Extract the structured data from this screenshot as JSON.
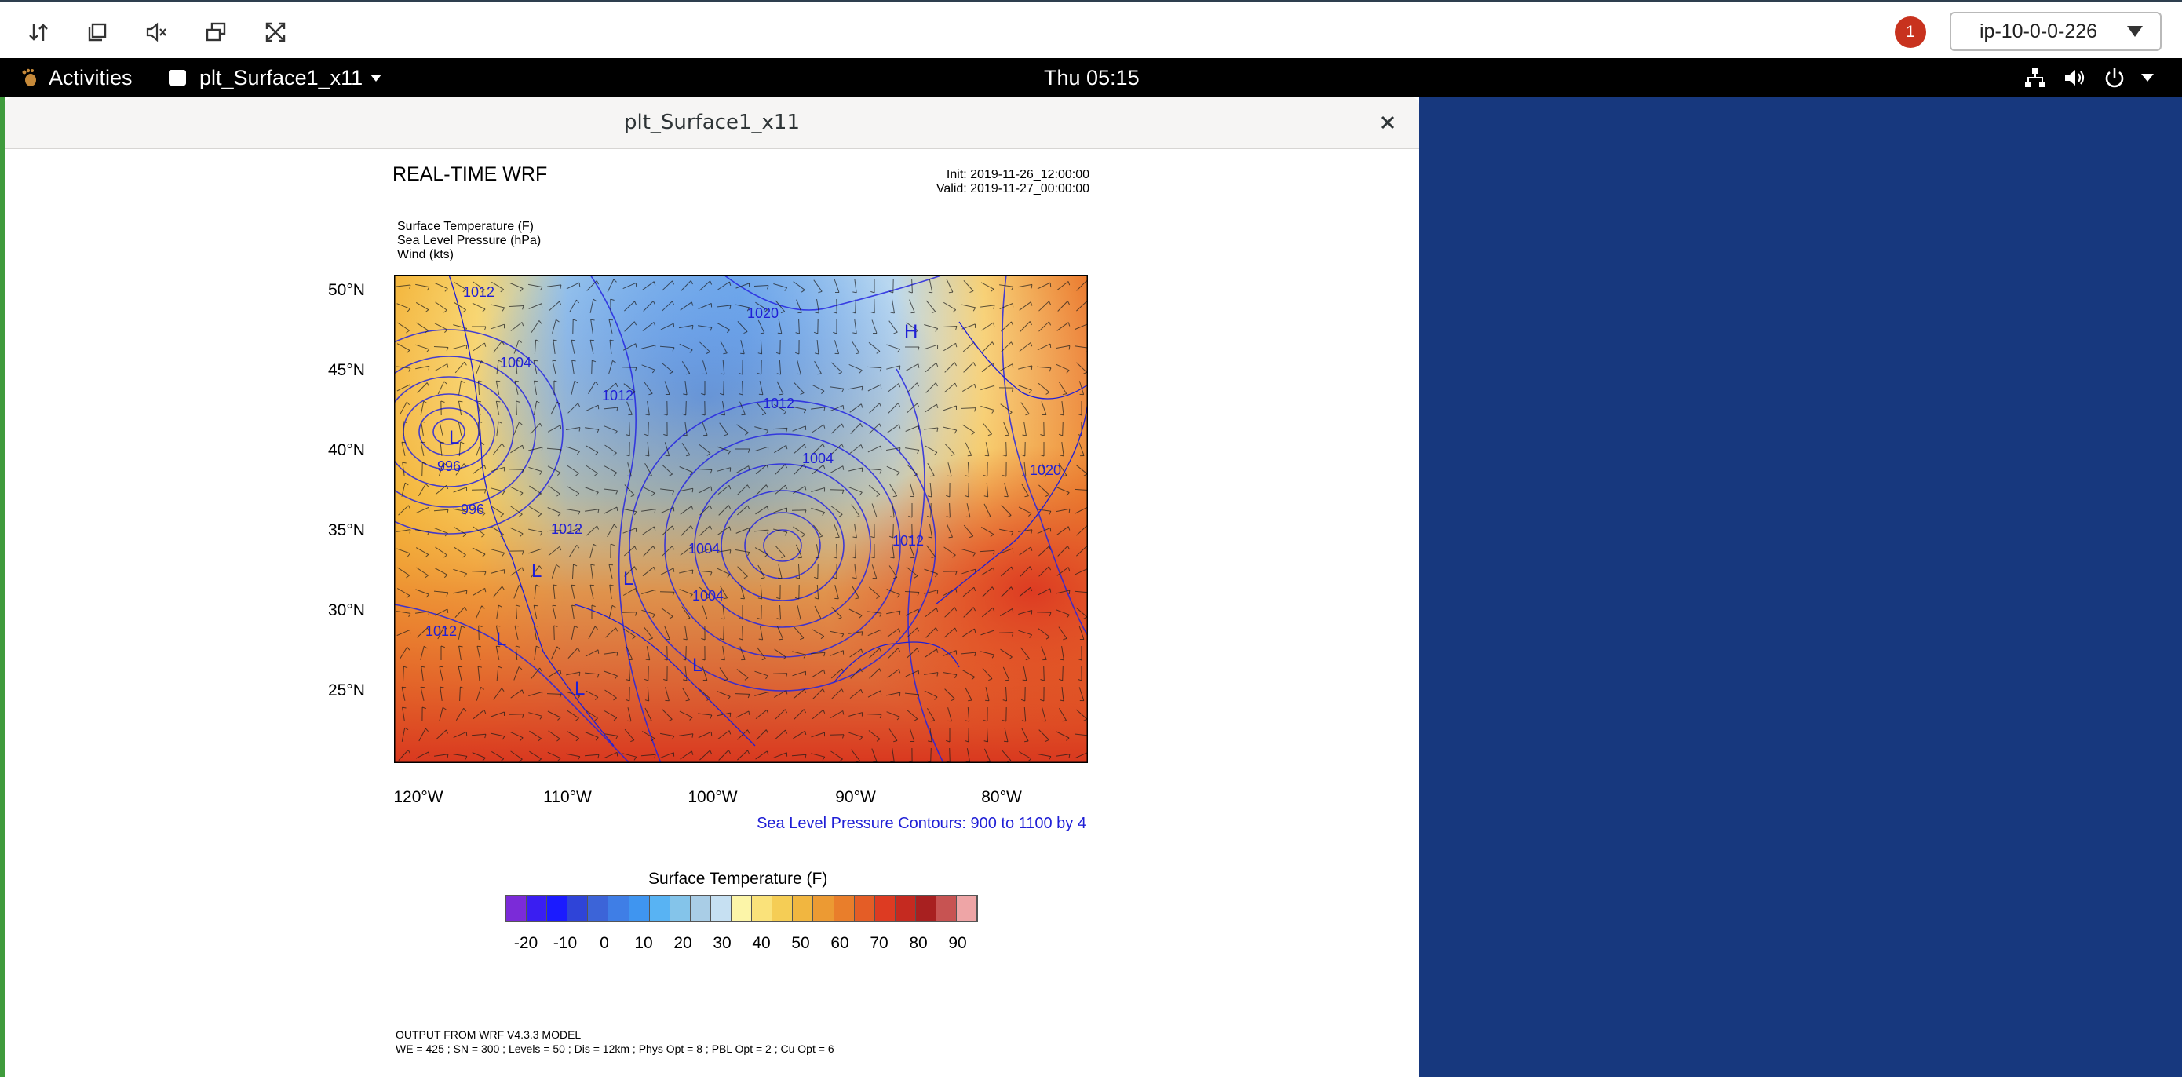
{
  "viewer_toolbar": {
    "buttons": [
      {
        "name": "sort-arrows-icon"
      },
      {
        "name": "copy-icon"
      },
      {
        "name": "mute-icon"
      },
      {
        "name": "windows-icon"
      },
      {
        "name": "fullscreen-icon"
      }
    ],
    "notification_count": "1",
    "host": "ip-10-0-0-226"
  },
  "top_bar": {
    "activities": "Activities",
    "app_name": "plt_Surface1_x11",
    "clock": "Thu 05:15"
  },
  "window": {
    "title": "plt_Surface1_x11"
  },
  "plot": {
    "title": "REAL-TIME WRF",
    "init": "Init: 2019-11-26_12:00:00",
    "valid": "Valid: 2019-11-27_00:00:00",
    "fields": [
      "Surface Temperature   (F)",
      "Sea Level Pressure   (hPa)",
      "Wind   (kts)"
    ],
    "lat_labels": [
      "50°N",
      "45°N",
      "40°N",
      "35°N",
      "30°N",
      "25°N"
    ],
    "lon_labels": [
      "120°W",
      "110°W",
      "100°W",
      "90°W",
      "80°W"
    ],
    "contour_note": "Sea Level Pressure Contours: 900 to 1100 by 4",
    "colorbar_title": "Surface Temperature  (F)",
    "colorbar_labels": [
      "-20",
      "-10",
      "0",
      "10",
      "20",
      "30",
      "40",
      "50",
      "60",
      "70",
      "80",
      "90"
    ],
    "contour_labels": [
      "1012",
      "1020",
      "1004",
      "1012",
      "1012",
      "1004",
      "1020",
      "996",
      "1004",
      "1012",
      "996",
      "1012",
      "1004",
      "1012",
      "H",
      "L",
      "L",
      "L",
      "L",
      "L",
      "L"
    ],
    "footer_1": "OUTPUT FROM WRF V4.3.3 MODEL",
    "footer_2": "WE = 425 ; SN = 300 ; Levels = 50 ; Dis = 12km ; Phys Opt = 8 ; PBL Opt = 2 ; Cu Opt = 6",
    "accent_color": "#1f1fd6"
  },
  "colorbar_colors": [
    "#7b2bd8",
    "#3a1ef2",
    "#1b1bff",
    "#2f44d8",
    "#3c64d8",
    "#3f7ee6",
    "#3f95f0",
    "#58b3f3",
    "#84c4ea",
    "#a9cde6",
    "#c6e0f2",
    "#fcf5a8",
    "#fae27a",
    "#f5cd55",
    "#f1b640",
    "#ec9a33",
    "#e97e2b",
    "#e45d26",
    "#dd3b22",
    "#c52a20",
    "#a82020",
    "#c75352",
    "#eea5a6"
  ],
  "desktop_color": "#17387e"
}
